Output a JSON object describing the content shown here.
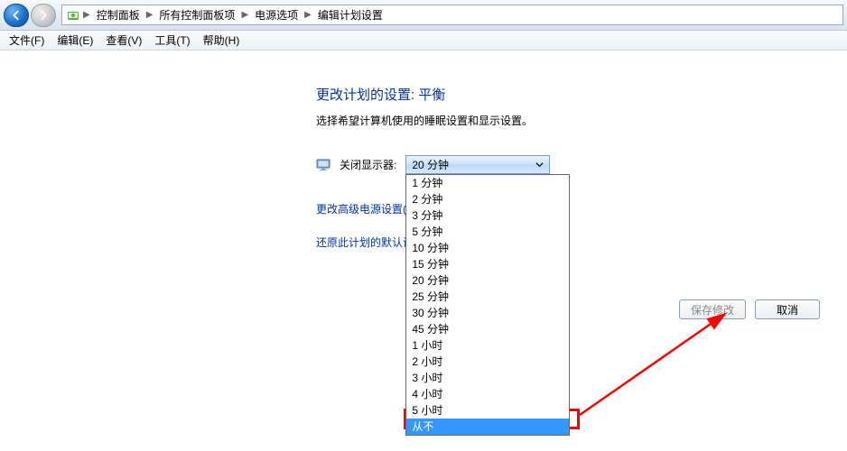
{
  "nav": {
    "breadcrumbs": [
      "控制面板",
      "所有控制面板项",
      "电源选项",
      "编辑计划设置"
    ]
  },
  "menu": {
    "items": [
      "文件(F)",
      "编辑(E)",
      "查看(V)",
      "工具(T)",
      "帮助(H)"
    ]
  },
  "page": {
    "title": "更改计划的设置: 平衡",
    "description": "选择希望计算机使用的睡眠设置和显示设置。"
  },
  "setting": {
    "label": "关闭显示器:",
    "selected": "20 分钟",
    "options": [
      "1 分钟",
      "2 分钟",
      "3 分钟",
      "5 分钟",
      "10 分钟",
      "15 分钟",
      "20 分钟",
      "25 分钟",
      "30 分钟",
      "45 分钟",
      "1 小时",
      "2 小时",
      "3 小时",
      "4 小时",
      "5 小时",
      "从不"
    ],
    "highlighted_index": 15
  },
  "links": {
    "advanced": "更改高级电源设置(C",
    "restore": "还原此计划的默认设"
  },
  "buttons": {
    "save": "保存修改",
    "cancel": "取消"
  }
}
